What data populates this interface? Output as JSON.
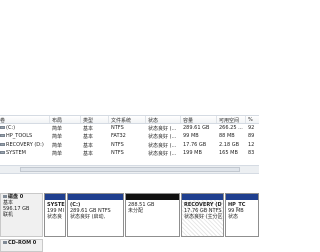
{
  "table": {
    "columns": [
      "卷",
      "布局",
      "类型",
      "文件系统",
      "状态",
      "容量",
      "可用空间",
      "%"
    ],
    "rows": [
      {
        "vol": "(C:)",
        "layout": "简单",
        "type": "基本",
        "fs": "NTFS",
        "status": "状态良好 (...",
        "cap": "289.61 GB",
        "free": "266.25 ...",
        "pct": "92"
      },
      {
        "vol": "HP_TOOLS",
        "layout": "简单",
        "type": "基本",
        "fs": "FAT32",
        "status": "状态良好 (...",
        "cap": "99 MB",
        "free": "88 MB",
        "pct": "89"
      },
      {
        "vol": "RECOVERY (D:)",
        "layout": "简单",
        "type": "基本",
        "fs": "NTFS",
        "status": "状态良好 (...",
        "cap": "17.76 GB",
        "free": "2.18 GB",
        "pct": "12"
      },
      {
        "vol": "SYSTEM",
        "layout": "简单",
        "type": "基本",
        "fs": "NTFS",
        "status": "状态良好 (...",
        "cap": "199 MB",
        "free": "165 MB",
        "pct": "83"
      }
    ]
  },
  "disk0": {
    "label": "磁盘 0",
    "type": "基本",
    "size": "596.17 GB",
    "status": "联机"
  },
  "volumes": [
    {
      "name": "SYSTEM",
      "size": "199 MI",
      "status": "状态良"
    },
    {
      "name": "(C:)",
      "size": "289.61 GB NTFS",
      "status": "状态良好 (启动,"
    },
    {
      "name": "",
      "size": "288.51 GB",
      "status": "未分配"
    },
    {
      "name": "RECOVERY (D",
      "size": "17.76 GB NTFS",
      "status": "状态良好 (主分区"
    },
    {
      "name": "HP_TC",
      "size": "99 MB",
      "status": "状态"
    }
  ],
  "cdrom": {
    "label": "CD-ROM 0"
  }
}
